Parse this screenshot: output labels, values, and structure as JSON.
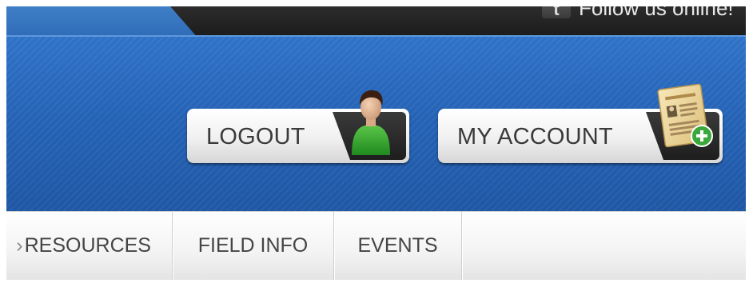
{
  "topbar": {
    "follow_text": "Follow us online!",
    "social_icon_letter": "t"
  },
  "header": {
    "logout_label": "LOGOUT",
    "my_account_label": "MY ACCOUNT"
  },
  "nav": {
    "items": [
      {
        "label": "RESOURCES"
      },
      {
        "label": "FIELD INFO"
      },
      {
        "label": "EVENTS"
      }
    ]
  },
  "colors": {
    "header_blue": "#2563b6",
    "topbar_dark": "#1b1b1b",
    "nav_text": "#444444",
    "button_text": "#3a3a3a",
    "badge_green": "#3aa83a"
  },
  "icons": {
    "logout": "person-icon",
    "my_account": "address-book-icon",
    "social": "social-icon"
  }
}
